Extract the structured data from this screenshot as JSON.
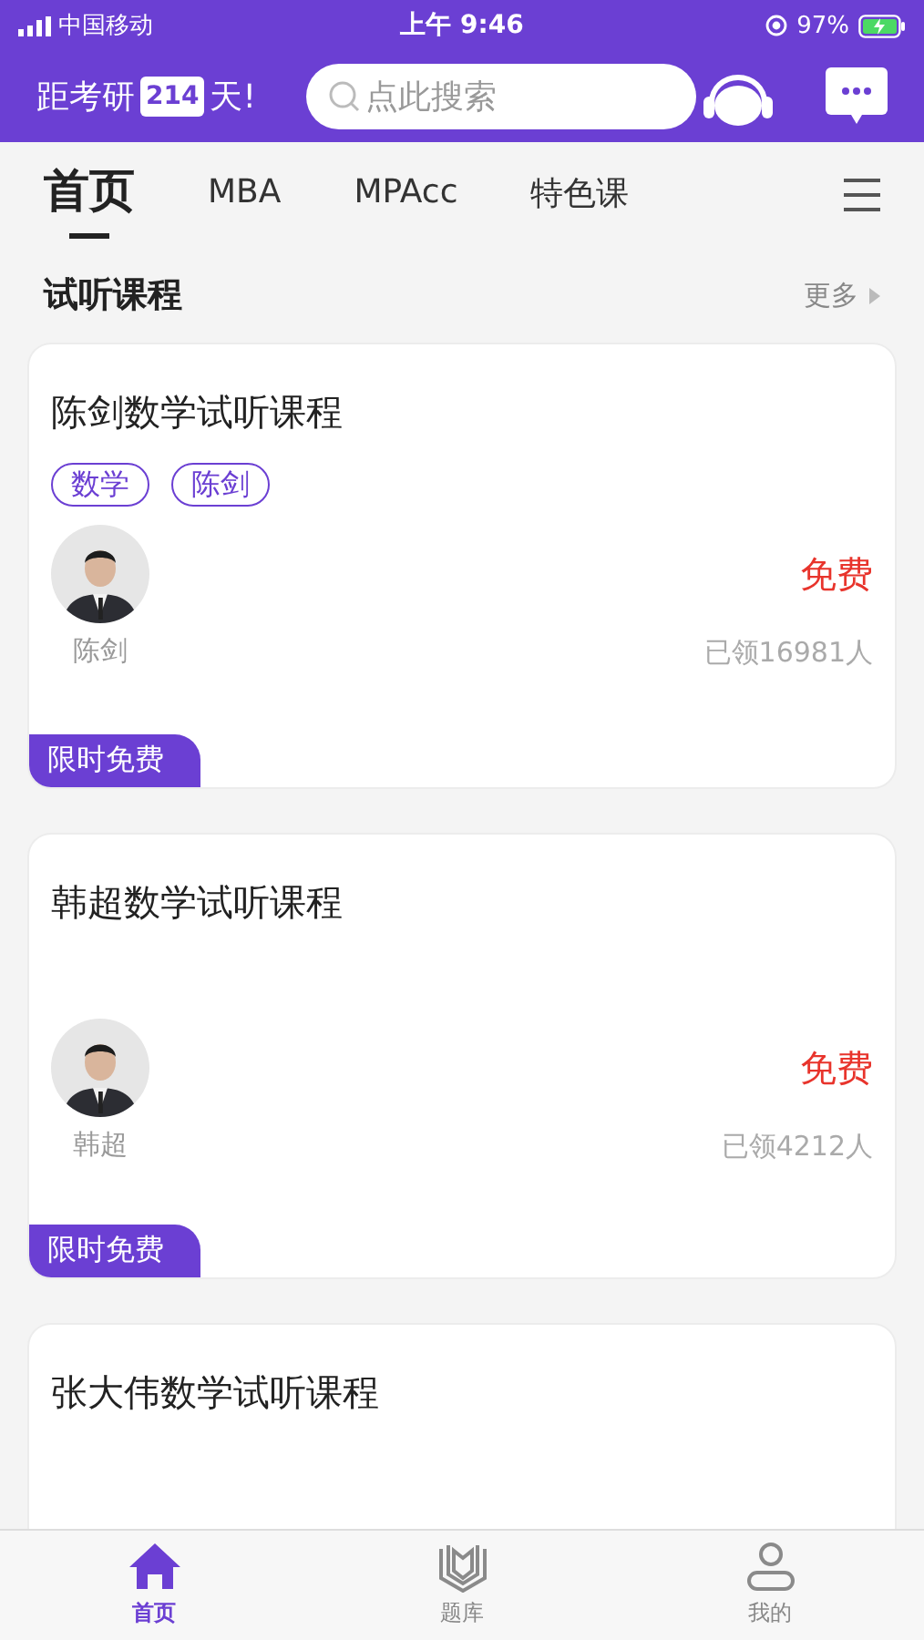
{
  "status_bar": {
    "carrier": "中国移动",
    "time": "上午 9:46",
    "battery": "97%"
  },
  "header": {
    "countdown_prefix": "距考研",
    "days": "214",
    "countdown_suffix": "天!",
    "search": {
      "placeholder": "点此搜索"
    }
  },
  "tabs": [
    {
      "label": "首页",
      "selected": true
    },
    {
      "label": "MBA",
      "selected": false
    },
    {
      "label": "MPAcc",
      "selected": false
    },
    {
      "label": "特色课",
      "selected": false
    }
  ],
  "section": {
    "title": "试听课程",
    "more": "更多"
  },
  "courses": [
    {
      "title": "陈剑数学试听课程",
      "tags": [
        "数学",
        "陈剑"
      ],
      "teacher": "陈剑",
      "price": "免费",
      "enrolled": "已领16981人",
      "badge": "限时免费"
    },
    {
      "title": "韩超数学试听课程",
      "teacher": "韩超",
      "price": "免费",
      "enrolled": "已领4212人",
      "badge": "限时免费"
    },
    {
      "title": "张大伟数学试听课程"
    }
  ],
  "bottom_nav": [
    {
      "label": "首页",
      "kind": "home",
      "selected": true
    },
    {
      "label": "题库",
      "kind": "book",
      "selected": false
    },
    {
      "label": "我的",
      "kind": "person",
      "selected": false
    }
  ]
}
